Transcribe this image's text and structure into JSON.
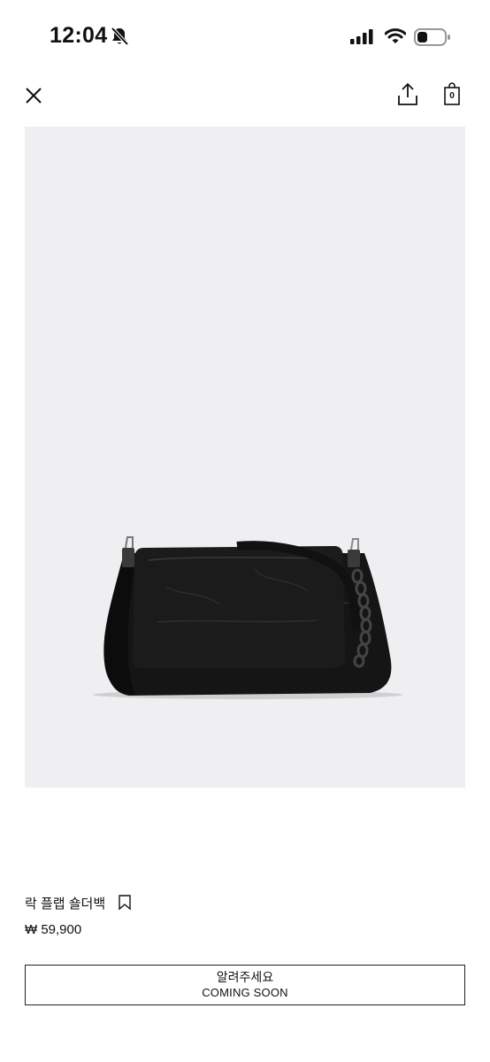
{
  "status_bar": {
    "time": "12:04",
    "icons": [
      "bell-slash-icon",
      "cellular-signal-icon",
      "wifi-icon",
      "battery-icon"
    ]
  },
  "nav": {
    "icons": [
      "close-icon",
      "share-icon",
      "shopping-bag-icon"
    ],
    "bag_count": "0"
  },
  "product": {
    "image_subject": "black leather flap shoulder bag with chain strap",
    "name": "락 플랩 숄더백",
    "price": "₩ 59,900"
  },
  "notify_button": {
    "label": "알려주세요",
    "sublabel": "COMING SOON"
  },
  "colors": {
    "image_bg": "#efeff1",
    "text": "#111111",
    "button_border": "#222222"
  }
}
